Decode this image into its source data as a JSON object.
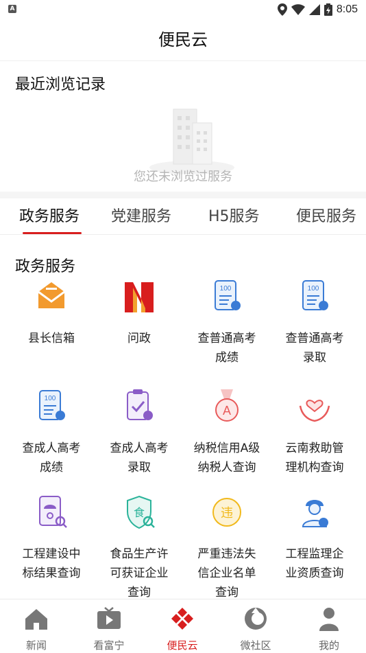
{
  "status_bar": {
    "app_indicator": "A",
    "time": "8:05"
  },
  "header": {
    "title": "便民云"
  },
  "recent": {
    "title": "最近浏览记录",
    "empty_text": "您还未浏览过服务"
  },
  "tabs": [
    {
      "label": "政务服务",
      "active": true
    },
    {
      "label": "党建服务",
      "active": false
    },
    {
      "label": "H5服务",
      "active": false
    },
    {
      "label": "便民服务",
      "active": false
    }
  ],
  "section": {
    "title": "政务服务"
  },
  "services": [
    {
      "label": "县长信箱",
      "icon": "mailbox-icon"
    },
    {
      "label": "问政",
      "icon": "wenzheng-logo-icon"
    },
    {
      "label": "查普通高考\n成绩",
      "icon": "score-report-icon"
    },
    {
      "label": "查普通高考\n录取",
      "icon": "score-report-icon"
    },
    {
      "label": "查成人高考\n成绩",
      "icon": "adult-score-icon"
    },
    {
      "label": "查成人高考\n录取",
      "icon": "adult-admission-icon"
    },
    {
      "label": "纳税信用A级\n纳税人查询",
      "icon": "medal-a-icon"
    },
    {
      "label": "云南救助管\n理机构查询",
      "icon": "helping-hands-icon"
    },
    {
      "label": "工程建设中\n标结果查询",
      "icon": "construction-search-icon"
    },
    {
      "label": "食品生产许\n可获证企业\n查询",
      "icon": "food-license-icon"
    },
    {
      "label": "严重违法失\n信企业名单\n查询",
      "icon": "violation-icon"
    },
    {
      "label": "工程监理企\n业资质查询",
      "icon": "engineer-icon"
    }
  ],
  "bottom_nav": [
    {
      "label": "新闻",
      "icon": "home-icon",
      "active": false
    },
    {
      "label": "看富宁",
      "icon": "tv-icon",
      "active": false
    },
    {
      "label": "便民云",
      "icon": "bianminyun-icon",
      "active": true
    },
    {
      "label": "微社区",
      "icon": "community-icon",
      "active": false
    },
    {
      "label": "我的",
      "icon": "profile-icon",
      "active": false
    }
  ],
  "colors": {
    "accent": "#d81e1e",
    "orange": "#f29a2e",
    "blue": "#3a7bd5",
    "purple": "#8a5cc7",
    "red_light": "#e85a5a",
    "green": "#2bb39a",
    "yellow": "#f1b91c"
  }
}
